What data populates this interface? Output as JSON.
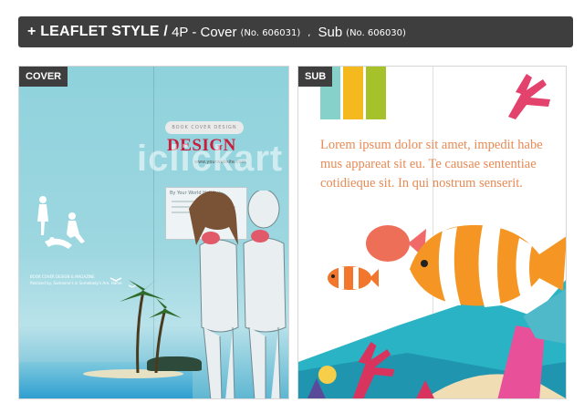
{
  "header": {
    "title": "+ LEAFLET STYLE /",
    "part1": "4P - Cover",
    "part1_no": "(No. 606031)",
    "separator": ",",
    "part2": "Sub",
    "part2_no": "(No. 606030)"
  },
  "cover": {
    "tag": "COVER",
    "badge": "BOOK COVER DESIGN",
    "design_title": "DESIGN",
    "url": "www.yourwebsite.com",
    "card_label": "By Your World Holiday",
    "small_text_1": "BOOK COVER DESIGN & MAGAZINE",
    "small_text_2": "Realized by, Someone's in Somebody's Are. Home"
  },
  "sub": {
    "tag": "SUB",
    "body_text": "Lorem ipsum dolor sit amet, impedit habe mus appareat sit eu. Te causae sententiae cotidieque sit. In qui nostrum senserit.",
    "stripe_colors": [
      "#86d1c9",
      "#f5b920",
      "#a5c22a"
    ]
  },
  "watermark": "iclickart"
}
